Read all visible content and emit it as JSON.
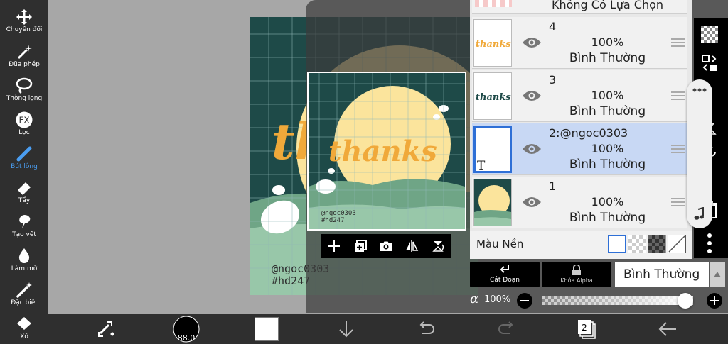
{
  "toolbar": {
    "tools": [
      {
        "label": "Chuyển đổi",
        "icon": "move-arrows-icon"
      },
      {
        "label": "Đũa phép",
        "icon": "magic-wand-icon"
      },
      {
        "label": "Thòng lọng",
        "icon": "lasso-icon"
      },
      {
        "label": "Lọc",
        "icon": "fx-filter-icon"
      },
      {
        "label": "Bút lông",
        "icon": "brush-icon",
        "active": true
      },
      {
        "label": "Tẩy",
        "icon": "eraser-icon"
      },
      {
        "label": "Tạo vết",
        "icon": "smudge-icon"
      },
      {
        "label": "Làm mờ",
        "icon": "blur-drop-icon"
      },
      {
        "label": "Đặc biệt",
        "icon": "special-wand-icon"
      },
      {
        "label": "Xô",
        "icon": "bucket-icon"
      }
    ]
  },
  "canvas": {
    "artwork_text": "thanks",
    "signature_line1": "@ngoc0303",
    "signature_line2": "#hd247"
  },
  "layers": {
    "top_partial_label": "Không Có Lựa Chọn",
    "items": [
      {
        "name": "4",
        "opacity": "100%",
        "blend": "Bình Thường",
        "thumb_text": "thanks"
      },
      {
        "name": "3",
        "opacity": "100%",
        "blend": "Bình Thường",
        "thumb_text": "thanks"
      },
      {
        "name": "2:@ngoc0303",
        "opacity": "100%",
        "blend": "Bình Thường",
        "thumb_text": "T",
        "selected": true
      },
      {
        "name": "1",
        "opacity": "100%",
        "blend": "Bình Thường",
        "thumb_text": ""
      }
    ],
    "background_label": "Màu Nền"
  },
  "layer_actions": {
    "clip_label": "Cắt Đoạn",
    "alpha_lock_label": "Khóa Alpha",
    "blend_mode_value": "Bình Thường"
  },
  "opacity": {
    "symbol": "α",
    "value": "100%",
    "value_fraction": 1.0
  },
  "bottom": {
    "brush_size": "88.0",
    "layer_count": "2"
  },
  "colors": {
    "toolbar_bg": "#2f2f2f",
    "accent_blue": "#4a9df0",
    "canvas_teal": "#1e4a48",
    "moon_yellow": "#fbe49c",
    "hill_green": "#6fa586",
    "lettering_orange": "#f0a93a",
    "selected_layer": "#c8d8f4"
  }
}
